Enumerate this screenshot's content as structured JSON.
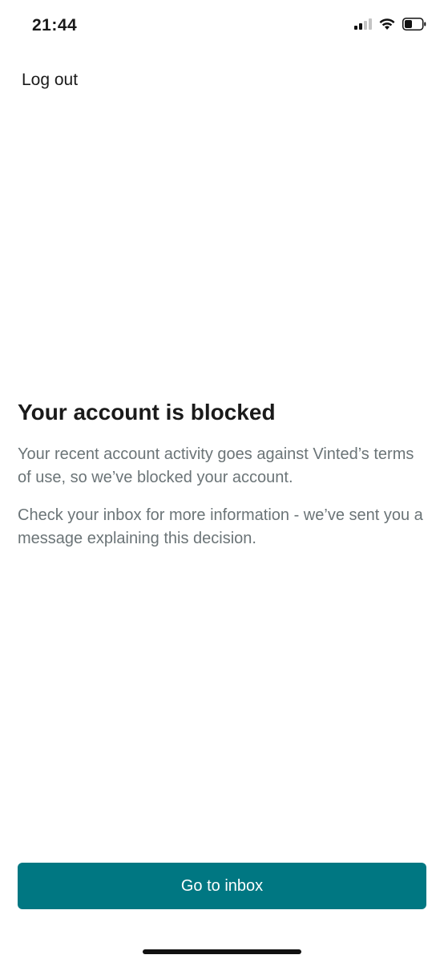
{
  "status_bar": {
    "time": "21:44",
    "signal_icon": "cellular-signal-icon",
    "wifi_icon": "wifi-icon",
    "battery_icon": "battery-icon"
  },
  "header": {
    "logout_label": "Log out"
  },
  "main": {
    "title": "Your account is blocked",
    "paragraph_1": "Your recent account activity goes against Vinted’s terms of use, so we’ve blocked your account.",
    "paragraph_2": "Check your inbox for more information - we’ve sent you a message explaining this decision."
  },
  "footer": {
    "button_label": "Go to inbox"
  },
  "colors": {
    "accent": "#007782",
    "body_text": "#6b7477",
    "title_text": "#1a1a1a"
  }
}
